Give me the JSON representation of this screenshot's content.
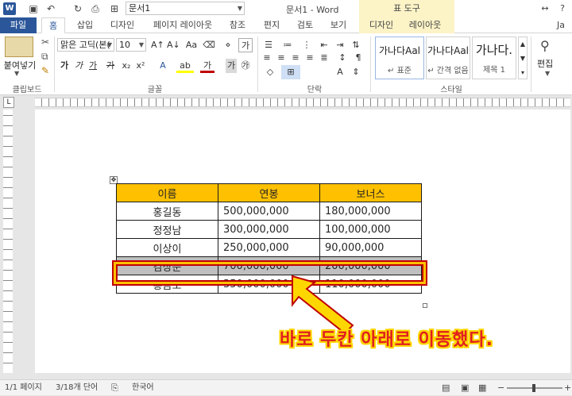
{
  "titlebar": {
    "app_icon": "W",
    "font_name": "문서1",
    "title": "문서1 - Word",
    "context_group": "표 도구",
    "help": "?",
    "restore": "↔",
    "minimize": "—"
  },
  "tabs": [
    {
      "label": "파일"
    },
    {
      "label": "홈"
    },
    {
      "label": "삽입"
    },
    {
      "label": "디자인"
    },
    {
      "label": "페이지 레이아웃"
    },
    {
      "label": "참조"
    },
    {
      "label": "편지"
    },
    {
      "label": "검토"
    },
    {
      "label": "보기"
    },
    {
      "label": "디자인"
    },
    {
      "label": "레이아웃"
    },
    {
      "label": "Ja"
    }
  ],
  "ribbon": {
    "paste_label": "붙여넣기",
    "font_family": "맑은 고딕(본(",
    "font_size": "10",
    "groups": {
      "clipboard": "클립보드",
      "font": "글꼴",
      "paragraph": "단락",
      "styles": "스타일"
    },
    "styles": [
      {
        "sample": "가나다Aal",
        "name": "↵ 표준"
      },
      {
        "sample": "가나다Aal",
        "name": "↵ 간격 없음"
      },
      {
        "sample": "가나다.",
        "name": "제목 1"
      }
    ],
    "edit_label": "편집"
  },
  "table": {
    "headers": [
      "이름",
      "연봉",
      "보너스"
    ],
    "rows": [
      [
        "홍길동",
        "500,000,000",
        "180,000,000"
      ],
      [
        "정정남",
        "300,000,000",
        "100,000,000"
      ],
      [
        "이상이",
        "250,000,000",
        "90,000,000"
      ],
      [
        "김상순",
        "700,000,000",
        "200,000,000"
      ],
      [
        "홍금보",
        "350,000,000",
        "110,000,000"
      ]
    ],
    "highlighted_row_index": 3
  },
  "annotation": {
    "text": "바로 두칸 아래로 이동했다."
  },
  "statusbar": {
    "page": "1/1 페이지",
    "words": "3/18개 단어",
    "language": "한국어"
  },
  "colors": {
    "header_fill": "#ffc000",
    "highlight_row": "#bfbfbf",
    "annotation_text": "#e02020",
    "annotation_outline": "#ffd700",
    "word_blue": "#2b579a"
  }
}
